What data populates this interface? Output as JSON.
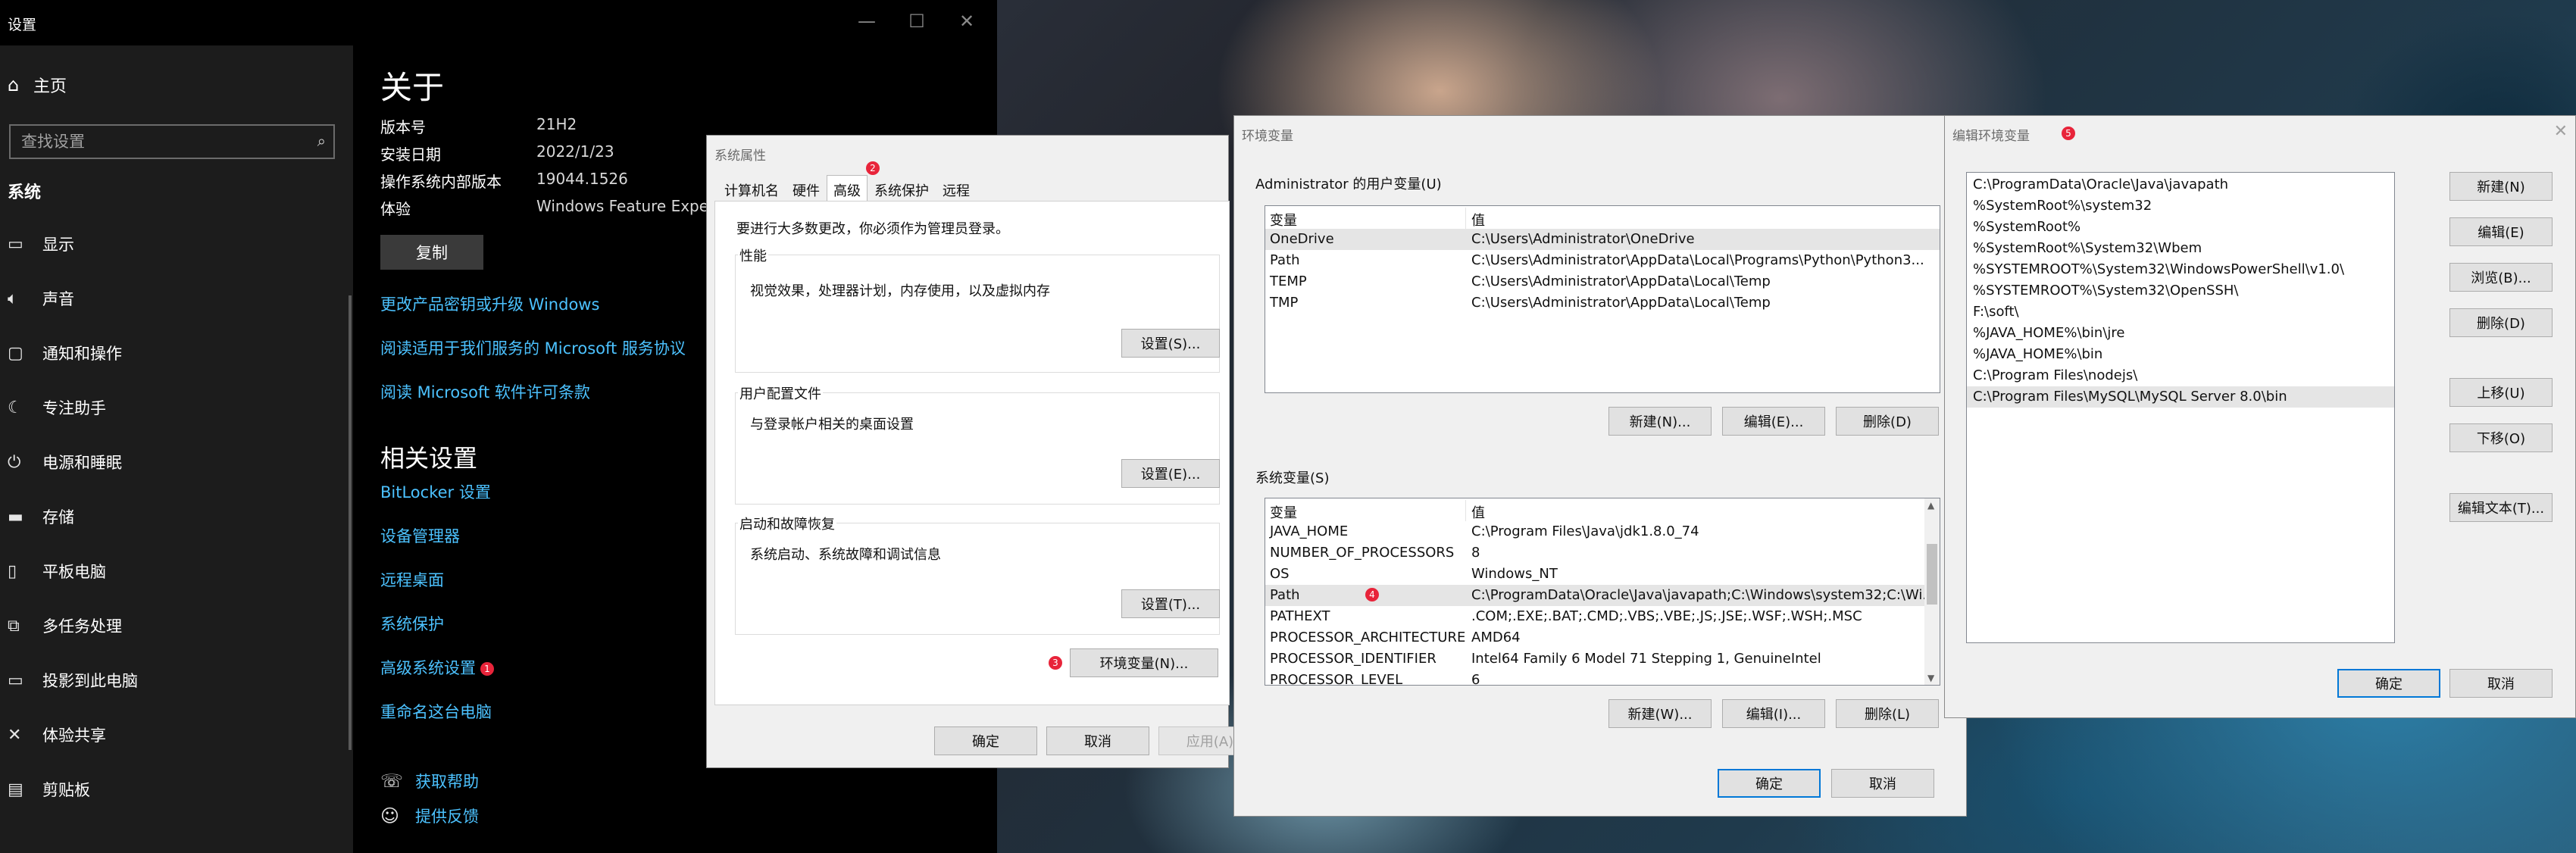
{
  "settings": {
    "app_title": "设置",
    "home": "主页",
    "search_placeholder": "查找设置",
    "section": "系统",
    "nav": [
      "显示",
      "声音",
      "通知和操作",
      "专注助手",
      "电源和睡眠",
      "存储",
      "平板电脑",
      "多任务处理",
      "投影到此电脑",
      "体验共享",
      "剪贴板"
    ],
    "page_title": "关于",
    "specs": [
      {
        "label": "版本号",
        "value": "21H2"
      },
      {
        "label": "安装日期",
        "value": "2022/1/23"
      },
      {
        "label": "操作系统内部版本",
        "value": "19044.1526"
      },
      {
        "label": "体验",
        "value": "Windows Feature Experi"
      }
    ],
    "copy_button": "复制",
    "links": [
      "更改产品密钥或升级 Windows",
      "阅读适用于我们服务的 Microsoft 服务协议",
      "阅读 Microsoft 软件许可条款"
    ],
    "related_title": "相关设置",
    "related_links": [
      "BitLocker 设置",
      "设备管理器",
      "远程桌面",
      "系统保护",
      "高级系统设置",
      "重命名这台电脑"
    ],
    "advanced_badge": "1",
    "help": [
      "获取帮助",
      "提供反馈"
    ]
  },
  "sysprop": {
    "title": "系统属性",
    "tabs": [
      "计算机名",
      "硬件",
      "高级",
      "系统保护",
      "远程"
    ],
    "active_tab": "高级",
    "tab_badge": "2",
    "admin_note": "要进行大多数更改，你必须作为管理员登录。",
    "perf_label": "性能",
    "perf_desc": "视觉效果，处理器计划，内存使用，以及虚拟内存",
    "perf_btn": "设置(S)...",
    "profile_label": "用户配置文件",
    "profile_desc": "与登录帐户相关的桌面设置",
    "profile_btn": "设置(E)...",
    "startup_label": "启动和故障恢复",
    "startup_desc": "系统启动、系统故障和调试信息",
    "startup_btn": "设置(T)...",
    "env_badge": "3",
    "env_btn": "环境变量(N)...",
    "ok": "确定",
    "cancel": "取消",
    "apply": "应用(A)"
  },
  "envvars": {
    "title": "环境变量",
    "user_section": "Administrator 的用户变量(U)",
    "col_var": "变量",
    "col_val": "值",
    "user_rows": [
      {
        "name": "OneDrive",
        "value": "C:\\Users\\Administrator\\OneDrive"
      },
      {
        "name": "Path",
        "value": "C:\\Users\\Administrator\\AppData\\Local\\Programs\\Python\\Python3..."
      },
      {
        "name": "TEMP",
        "value": "C:\\Users\\Administrator\\AppData\\Local\\Temp"
      },
      {
        "name": "TMP",
        "value": "C:\\Users\\Administrator\\AppData\\Local\\Temp"
      }
    ],
    "user_new": "新建(N)...",
    "user_edit": "编辑(E)...",
    "user_delete": "删除(D)",
    "sys_section": "系统变量(S)",
    "sys_rows": [
      {
        "name": "JAVA_HOME",
        "value": "C:\\Program Files\\Java\\jdk1.8.0_74"
      },
      {
        "name": "NUMBER_OF_PROCESSORS",
        "value": "8"
      },
      {
        "name": "OS",
        "value": "Windows_NT"
      },
      {
        "name": "Path",
        "value": "C:\\ProgramData\\Oracle\\Java\\javapath;C:\\Windows\\system32;C:\\Wi..."
      },
      {
        "name": "PATHEXT",
        "value": ".COM;.EXE;.BAT;.CMD;.VBS;.VBE;.JS;.JSE;.WSF;.WSH;.MSC"
      },
      {
        "name": "PROCESSOR_ARCHITECTURE",
        "value": "AMD64"
      },
      {
        "name": "PROCESSOR_IDENTIFIER",
        "value": "Intel64 Family 6 Model 71 Stepping 1, GenuineIntel"
      },
      {
        "name": "PROCESSOR_LEVEL",
        "value": "6"
      }
    ],
    "path_badge": "4",
    "sys_new": "新建(W)...",
    "sys_edit": "编辑(I)...",
    "sys_delete": "删除(L)",
    "ok": "确定",
    "cancel": "取消"
  },
  "editenv": {
    "title": "编辑环境变量",
    "title_badge": "5",
    "paths": [
      "C:\\ProgramData\\Oracle\\Java\\javapath",
      "%SystemRoot%\\system32",
      "%SystemRoot%",
      "%SystemRoot%\\System32\\Wbem",
      "%SYSTEMROOT%\\System32\\WindowsPowerShell\\v1.0\\",
      "%SYSTEMROOT%\\System32\\OpenSSH\\",
      "F:\\soft\\",
      "%JAVA_HOME%\\bin\\jre",
      "%JAVA_HOME%\\bin",
      "C:\\Program Files\\nodejs\\",
      "C:\\Program Files\\MySQL\\MySQL Server 8.0\\bin"
    ],
    "new": "新建(N)",
    "edit": "编辑(E)",
    "browse": "浏览(B)...",
    "delete": "删除(D)",
    "move_up": "上移(U)",
    "move_down": "下移(O)",
    "edit_text": "编辑文本(T)...",
    "ok": "确定",
    "cancel": "取消"
  }
}
